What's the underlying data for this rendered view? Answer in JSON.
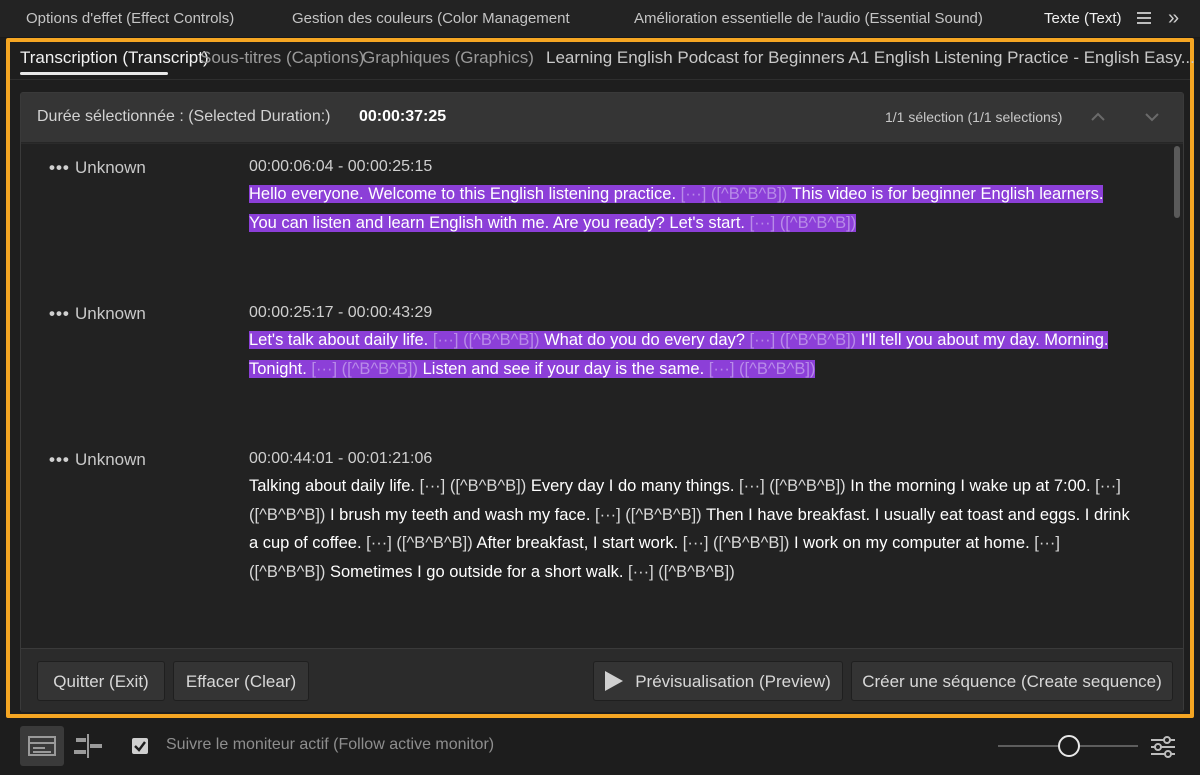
{
  "panel_tabs": [
    {
      "label": "Options d'effet (Effect Controls)"
    },
    {
      "label": "Gestion des couleurs (Color Management"
    },
    {
      "label": "Amélioration essentielle de l'audio (Essential Sound)"
    },
    {
      "label": "Texte (Text)"
    }
  ],
  "panel_menu_icon": "hamburger-menu-icon",
  "panel_overflow": "»",
  "sub_tabs": [
    {
      "label": "Transcription (Transcript)"
    },
    {
      "label": "Sous-titres (Captions)"
    },
    {
      "label": "Graphiques (Graphics)"
    },
    {
      "label": "Learning English Podcast for Beginners A1 English Listening Practice - English Easy..."
    }
  ],
  "duration": {
    "label": "Durée sélectionnée : (Selected Duration:)",
    "value": "00:00:37:25",
    "selection_count": "1/1 sélection (1/1 selections)"
  },
  "transcript": [
    {
      "speaker": "Unknown",
      "timestamp": "00:00:06:04 - 00:00:25:15",
      "selected": true,
      "lines": [
        [
          {
            "t": "Hello everyone. Welcome to this English listening practice. "
          },
          {
            "m": "[···] ([^B^B^B])"
          },
          {
            "t": " This video is for beginner English learners."
          }
        ],
        [
          {
            "t": "You can listen and learn English with me. Are you ready? Let's start. "
          },
          {
            "m": "[···] ([^B^B^B])"
          }
        ]
      ]
    },
    {
      "speaker": "Unknown",
      "timestamp": "00:00:25:17 - 00:00:43:29",
      "selected": true,
      "lines": [
        [
          {
            "t": "Let's talk about daily life. "
          },
          {
            "m": "[···] ([^B^B^B])"
          },
          {
            "t": " What do you do every day? "
          },
          {
            "m": "[···] ([^B^B^B])"
          },
          {
            "t": " I'll tell you about my day. Morning."
          }
        ],
        [
          {
            "t": "Tonight. "
          },
          {
            "m": "[···] ([^B^B^B])"
          },
          {
            "t": " Listen and see if your day is the same. "
          },
          {
            "m": "[···] ([^B^B^B])"
          }
        ]
      ]
    },
    {
      "speaker": "Unknown",
      "timestamp": "00:00:44:01 - 00:01:21:06",
      "selected": false,
      "lines": [
        [
          {
            "t": "Talking about daily life. "
          },
          {
            "m": "[···] ([^B^B^B])"
          },
          {
            "t": " Every day I do many things. "
          },
          {
            "m": "[···] ([^B^B^B])"
          },
          {
            "t": " In the morning I wake up at 7:00. "
          },
          {
            "m": "[···]"
          }
        ],
        [
          {
            "m": "([^B^B^B])"
          },
          {
            "t": " I brush my teeth and wash my face. "
          },
          {
            "m": "[···] ([^B^B^B])"
          },
          {
            "t": " Then I have breakfast. I usually eat toast and eggs. I drink"
          }
        ],
        [
          {
            "t": "a cup of coffee. "
          },
          {
            "m": "[···] ([^B^B^B])"
          },
          {
            "t": " After breakfast, I start work. "
          },
          {
            "m": "[···] ([^B^B^B])"
          },
          {
            "t": " I work on my computer at home. "
          },
          {
            "m": "[···]"
          }
        ],
        [
          {
            "m": "([^B^B^B])"
          },
          {
            "t": " Sometimes I go outside for a short walk. "
          },
          {
            "m": "[···] ([^B^B^B])"
          }
        ]
      ]
    }
  ],
  "speaker_menu_glyph": "•••",
  "footer": {
    "exit_label": "Quitter (Exit)",
    "clear_label": "Effacer (Clear)",
    "preview_label": "Prévisualisation (Preview)",
    "create_label": "Créer une séquence (Create sequence)"
  },
  "bottom": {
    "follow_label": "Suivre le moniteur actif (Follow active monitor)",
    "follow_checked": true
  },
  "colors": {
    "frame_highlight": "#f5a623",
    "selection_highlight": "#8c3fd8",
    "marker_text": "#b88be8"
  }
}
